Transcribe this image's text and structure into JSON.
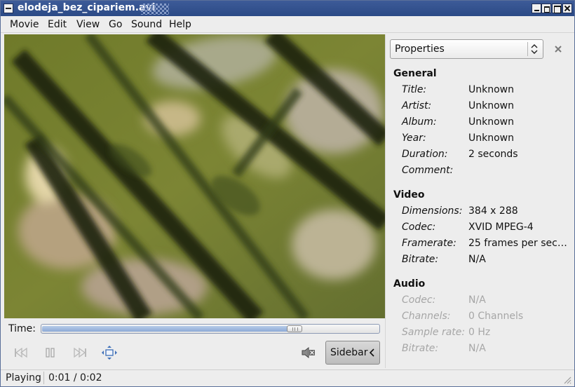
{
  "window": {
    "title": "elodeja_bez_cipariem.avi"
  },
  "menu": [
    "Movie",
    "Edit",
    "View",
    "Go",
    "Sound",
    "Help"
  ],
  "time": {
    "label": "Time:",
    "position_fraction": 0.75
  },
  "controls": {
    "sidebar_button": "Sidebar",
    "icons": [
      "skip-back-icon",
      "pause-icon",
      "skip-forward-icon",
      "fullscreen-icon",
      "volume-muted-icon"
    ]
  },
  "status": {
    "state": "Playing",
    "time": "0:01 / 0:02"
  },
  "sidebar": {
    "selector": "Properties",
    "general": {
      "heading": "General",
      "rows": [
        {
          "key": "Title:",
          "value": "Unknown"
        },
        {
          "key": "Artist:",
          "value": "Unknown"
        },
        {
          "key": "Album:",
          "value": "Unknown"
        },
        {
          "key": "Year:",
          "value": "Unknown"
        },
        {
          "key": "Duration:",
          "value": "2 seconds"
        },
        {
          "key": "Comment:",
          "value": ""
        }
      ]
    },
    "video": {
      "heading": "Video",
      "rows": [
        {
          "key": "Dimensions:",
          "value": "384 x 288"
        },
        {
          "key": "Codec:",
          "value": "XVID MPEG-4"
        },
        {
          "key": "Framerate:",
          "value": "25 frames per sec…"
        },
        {
          "key": "Bitrate:",
          "value": "N/A"
        }
      ]
    },
    "audio": {
      "heading": "Audio",
      "rows": [
        {
          "key": "Codec:",
          "value": "N/A"
        },
        {
          "key": "Channels:",
          "value": "0 Channels"
        },
        {
          "key": "Sample rate:",
          "value": "0 Hz"
        },
        {
          "key": "Bitrate:",
          "value": "N/A"
        }
      ]
    }
  }
}
